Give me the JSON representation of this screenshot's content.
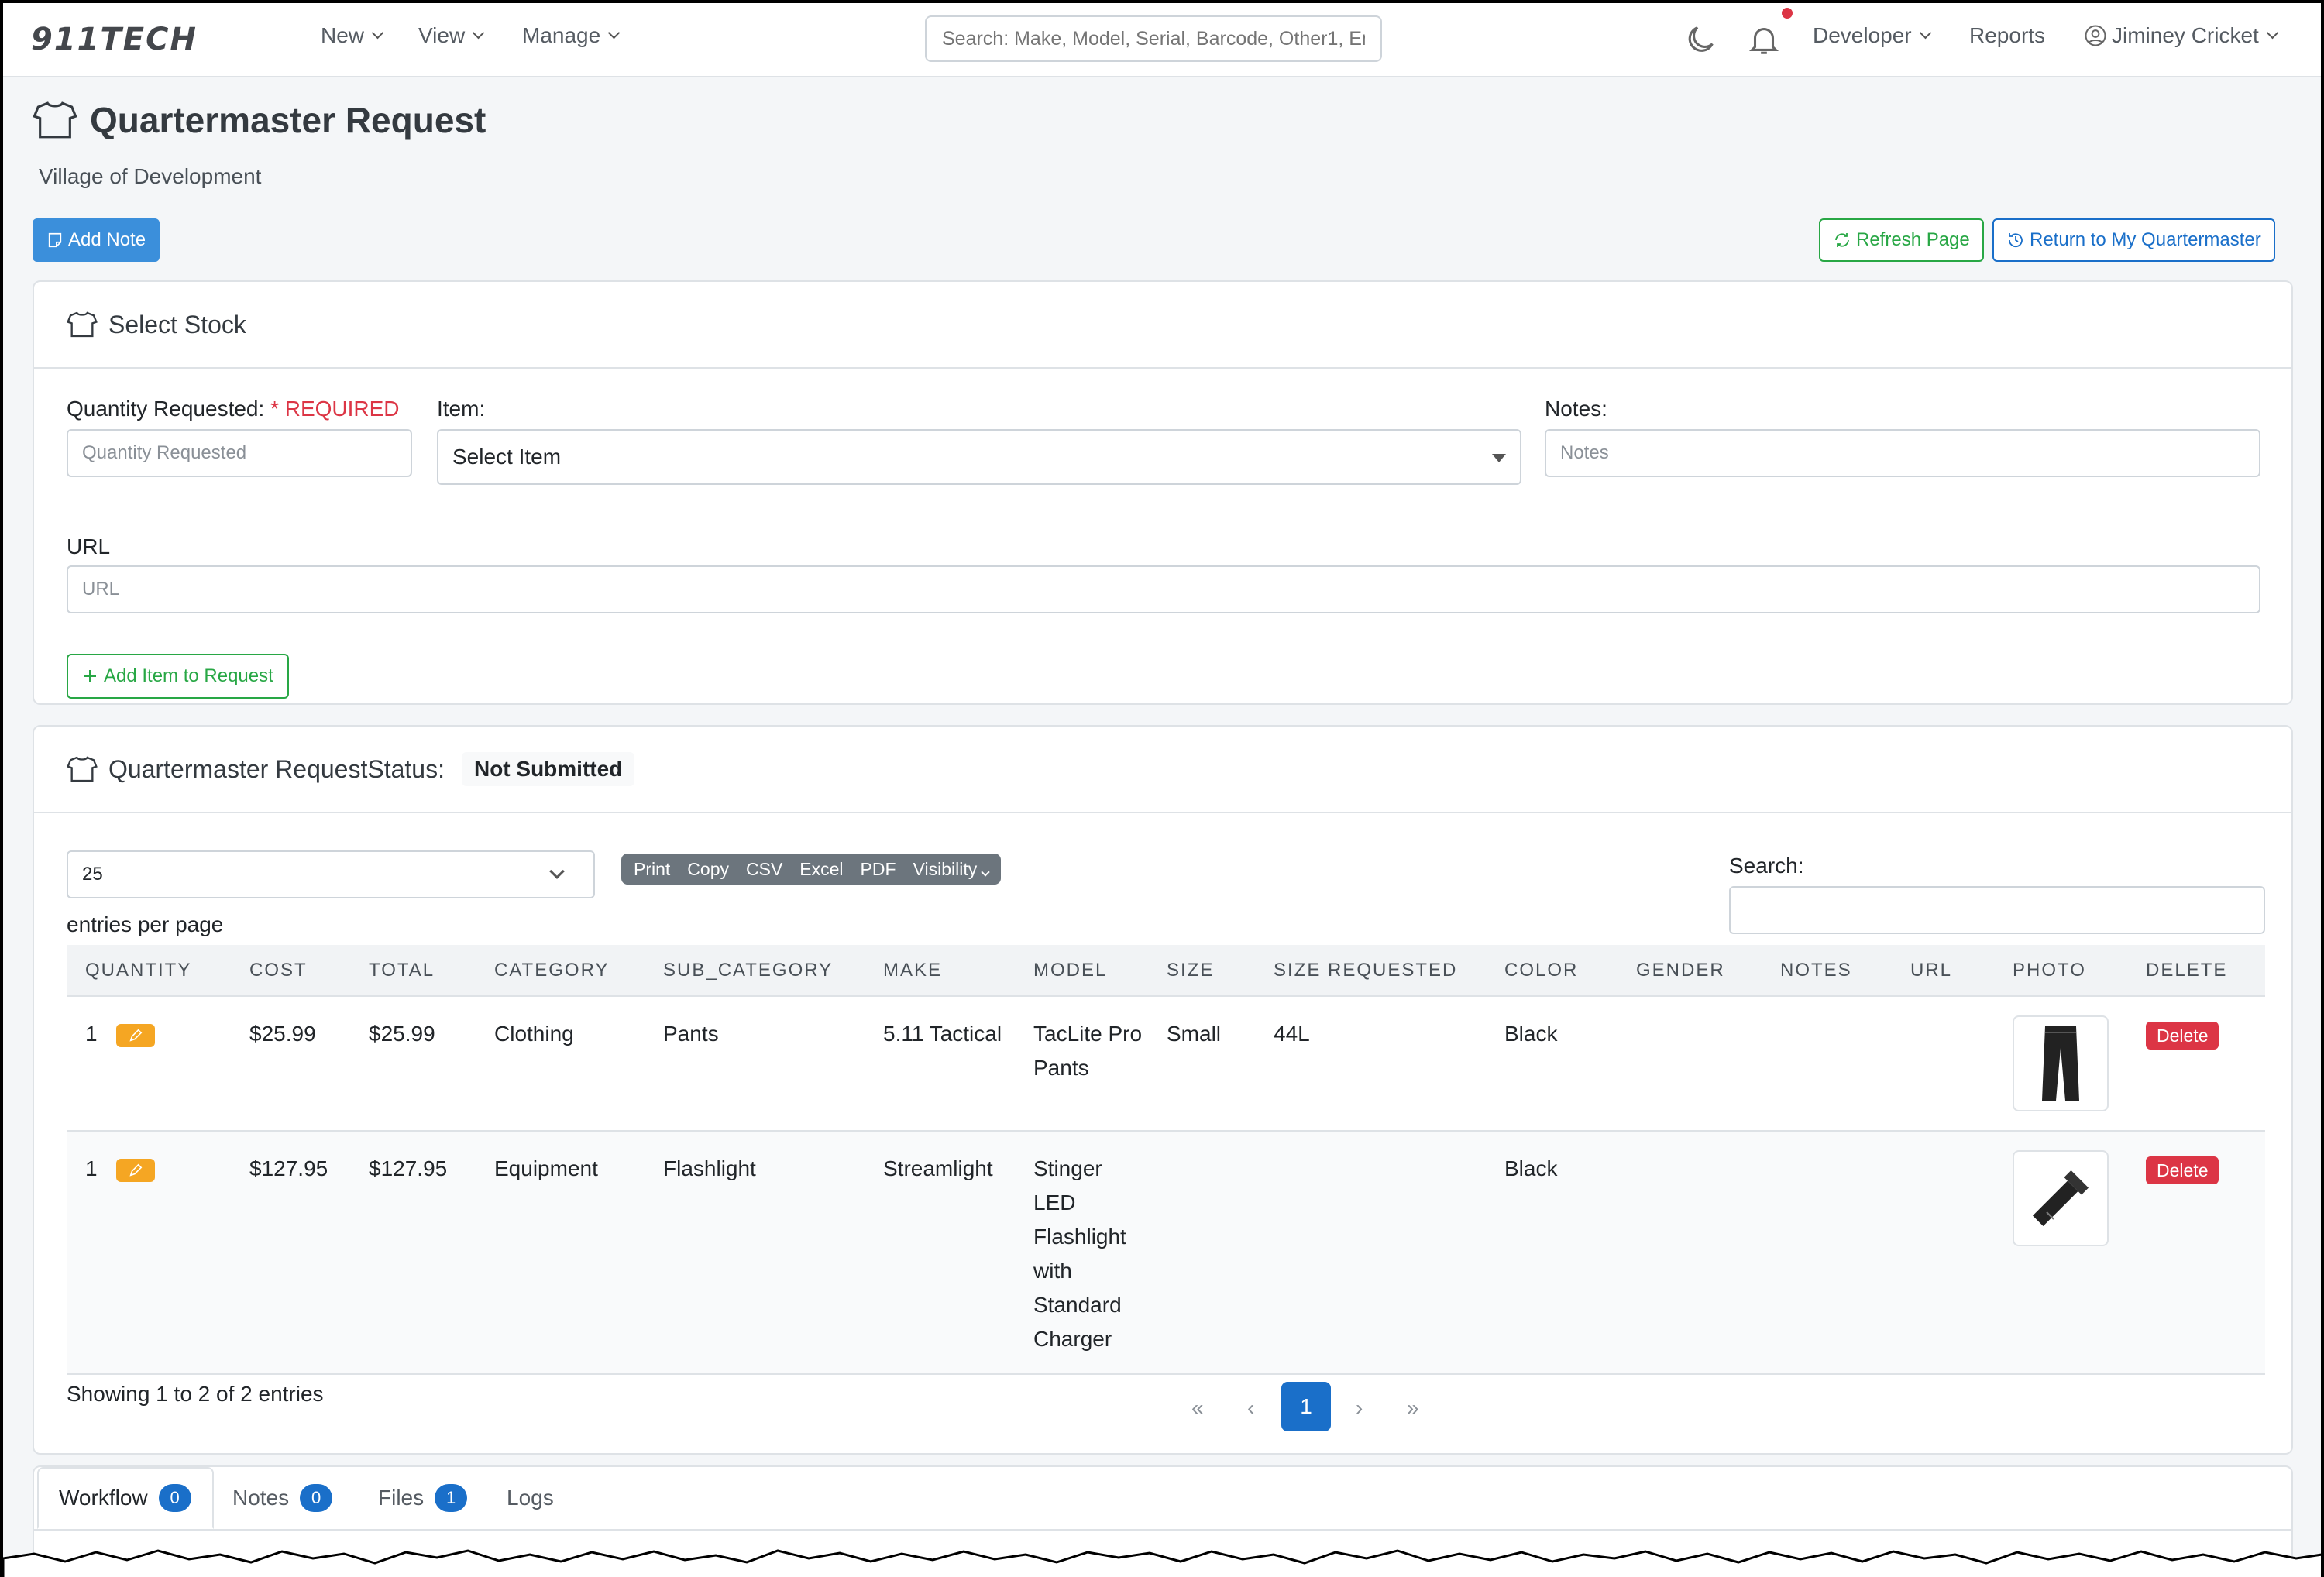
{
  "navbar": {
    "brand": "911TECH",
    "menu": [
      "New",
      "View",
      "Manage"
    ],
    "search_placeholder": "Search: Make, Model, Serial, Barcode, Other1, Em",
    "developer": "Developer",
    "reports": "Reports",
    "user": "Jiminey Cricket"
  },
  "header": {
    "title": "Quartermaster Request",
    "subtitle": "Village of Development",
    "add_note": "Add Note",
    "refresh": "Refresh Page",
    "return": "Return to My Quartermaster"
  },
  "select_stock": {
    "title": "Select Stock",
    "qty_label": "Quantity Requested:",
    "qty_required": "* REQUIRED",
    "qty_placeholder": "Quantity Requested",
    "item_label": "Item:",
    "item_value": "Select Item",
    "notes_label": "Notes:",
    "notes_placeholder": "Notes",
    "url_label": "URL",
    "url_placeholder": "URL",
    "add_button": "Add Item to Request"
  },
  "request": {
    "title": "Quartermaster RequestStatus:",
    "status": "Not Submitted",
    "entries_value": "25",
    "entries_label": "entries per page",
    "buttons": [
      "Print",
      "Copy",
      "CSV",
      "Excel",
      "PDF",
      "Visibility"
    ],
    "search_label": "Search:",
    "columns": [
      "QUANTITY",
      "COST",
      "TOTAL",
      "CATEGORY",
      "SUB_CATEGORY",
      "MAKE",
      "MODEL",
      "SIZE",
      "SIZE REQUESTED",
      "COLOR",
      "GENDER",
      "NOTES",
      "URL",
      "PHOTO",
      "DELETE"
    ],
    "rows": [
      {
        "quantity": "1",
        "cost": "$25.99",
        "total": "$25.99",
        "category": "Clothing",
        "sub_category": "Pants",
        "make": "5.11 Tactical",
        "model": "TacLite Pro Pants",
        "size": "Small",
        "size_requested": "44L",
        "color": "Black",
        "gender": "",
        "notes": "",
        "url": "",
        "photo": "pants-photo",
        "delete": "Delete"
      },
      {
        "quantity": "1",
        "cost": "$127.95",
        "total": "$127.95",
        "category": "Equipment",
        "sub_category": "Flashlight",
        "make": "Streamlight",
        "model": "Stinger LED Flashlight with Standard Charger",
        "size": "",
        "size_requested": "",
        "color": "Black",
        "gender": "",
        "notes": "",
        "url": "",
        "photo": "flashlight-photo",
        "delete": "Delete"
      }
    ],
    "showing": "Showing 1 to 2 of 2 entries",
    "pager": {
      "first": "«",
      "prev": "‹",
      "current": "1",
      "next": "›",
      "last": "»"
    }
  },
  "tabs": [
    {
      "label": "Workflow",
      "count": "0"
    },
    {
      "label": "Notes",
      "count": "0"
    },
    {
      "label": "Files",
      "count": "1"
    },
    {
      "label": "Logs"
    }
  ],
  "colors": {
    "primary": "#1a6fc9",
    "success": "#28a745",
    "danger": "#dc3545",
    "warning": "#f5a623"
  }
}
